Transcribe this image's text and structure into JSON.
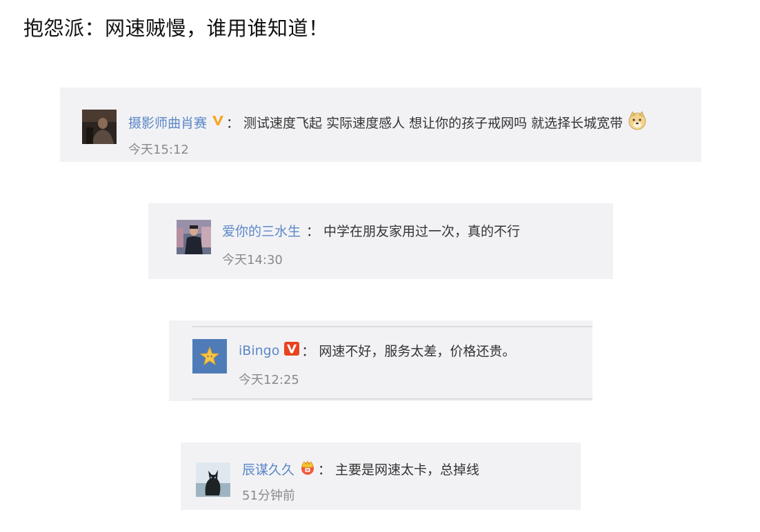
{
  "title": "抱怨派：网速贼慢，谁用谁知道！",
  "colors": {
    "card_background": "#f2f2f5",
    "username": "#5b87c6",
    "time": "#8a8a8a",
    "verified_yellow": "#f5a623",
    "verified_red": "#e8431f"
  },
  "comments": [
    {
      "user": "摄影师曲肖赛",
      "badge": "yellow-v-icon",
      "separator": "：",
      "text": "测试速度飞起 实际速度感人 想让你的孩子戒网吗 就选择长城宽带",
      "emoji": "doge-emoji-icon",
      "time": "今天15:12"
    },
    {
      "user": "爱你的三水生",
      "badge": "",
      "separator": "：",
      "text": "中学在朋友家用过一次，真的不行",
      "time": "今天14:30"
    },
    {
      "user": "iBingo",
      "badge": "red-v-icon",
      "separator": "：",
      "text": "网速不好，服务太差，价格还贵。",
      "time": "今天12:25"
    },
    {
      "user": "辰谋久久",
      "badge": "crown-icon",
      "separator": "：",
      "text": "主要是网速太卡，总掉线",
      "time": "51分钟前"
    }
  ]
}
